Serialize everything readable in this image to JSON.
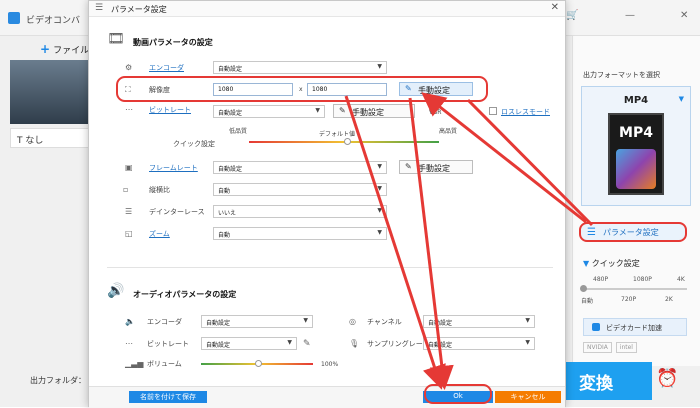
{
  "app": {
    "title": "ビデオコンバ",
    "add_file": "ファイル",
    "subtitle": "なし",
    "output_folder": "出力フォルダ：",
    "convert": "変換"
  },
  "right_panel": {
    "format_label": "出力フォーマットを選択",
    "format_name": "MP4",
    "format_badge": "MP4",
    "param_button": "パラメータ設定",
    "quick_label": "クイック設定",
    "quick_top_ticks": [
      "480P",
      "1080P",
      "4K"
    ],
    "quick_bottom_ticks": [
      "自動",
      "720P",
      "2K"
    ],
    "gpu_label": "ビデオカード加速",
    "vendors": [
      "NVIDIA",
      "intel"
    ]
  },
  "dialog": {
    "title": "パラメータ設定",
    "video_section": "動画パラメータの設定",
    "encoder_label": "エンコーダ",
    "encoder_value": "自動設定",
    "resolution_label": "解像度",
    "res_width": "1080",
    "res_x": "x",
    "res_height": "1080",
    "manual_label": "手動設定",
    "bitrate_label": "ビットレート",
    "bitrate_value": "自動設定",
    "vbr_label": "VBR",
    "lossless_label": "ロスレスモード",
    "quick_label": "クイック設定",
    "quality_low": "低品質",
    "quality_default": "デフォルト値",
    "quality_high": "高品質",
    "framerate_label": "フレームレート",
    "framerate_value": "自動設定",
    "aspect_label": "縦横比",
    "aspect_value": "自動",
    "deinterlace_label": "デインターレース",
    "deinterlace_value": "いいえ",
    "zoom_label": "ズーム",
    "zoom_value": "自動",
    "audio_section": "オーディオパラメータの設定",
    "a_encoder_label": "エンコーダ",
    "a_encoder_value": "自動設定",
    "channel_label": "チャンネル",
    "channel_value": "自動設定",
    "a_bitrate_label": "ビットレート",
    "a_bitrate_value": "自動設定",
    "samplerate_label": "サンプリングレート",
    "samplerate_value": "自動設定",
    "volume_label": "ボリューム",
    "volume_value": "100%",
    "save_as": "名前を付けて保存",
    "ok": "Ok",
    "cancel": "キャンセル"
  },
  "colors": {
    "accent": "#1e88e5",
    "annotation": "#e53935",
    "cancel": "#f57c00"
  }
}
